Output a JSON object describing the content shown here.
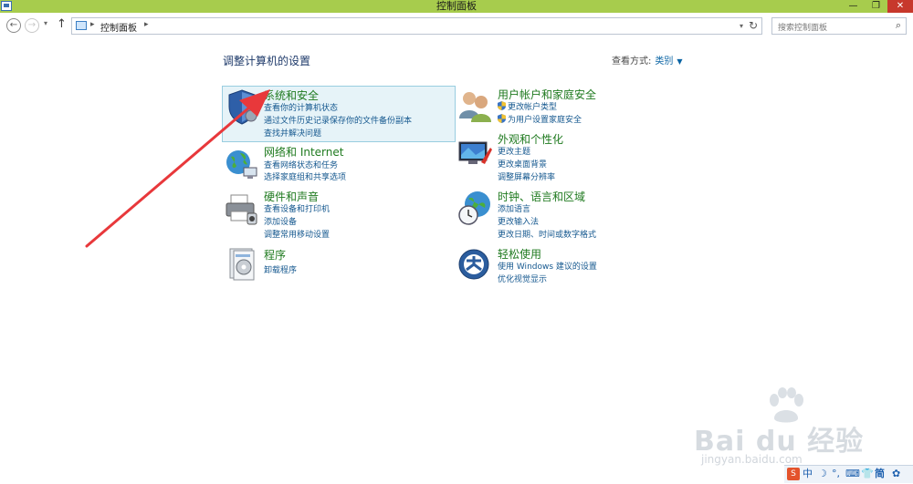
{
  "window": {
    "title": "控制面板",
    "min_glyph": "—",
    "max_glyph": "❐",
    "close_glyph": "✕",
    "titlebar_color": "#a7cc4d"
  },
  "navbar": {
    "back_glyph": "←",
    "forward_glyph": "→",
    "dropdown_glyph": "▾",
    "up_glyph": "↑",
    "breadcrumb_sep": "▸",
    "breadcrumb": "控制面板",
    "address_dropdown_glyph": "▾",
    "refresh_glyph": "↻",
    "search_placeholder": "搜索控制面板",
    "search_glyph": "⌕"
  },
  "content": {
    "heading": "调整计算机的设置",
    "viewby_label": "查看方式:",
    "viewby_value": "类别",
    "viewby_caret": "▼",
    "link_color": "#15588f",
    "title_color": "#1f7a1f"
  },
  "categories": [
    {
      "title": "系统和安全",
      "icon": "shield-icon",
      "links": [
        "查看你的计算机状态",
        "通过文件历史记录保存你的文件备份副本",
        "查找并解决问题"
      ]
    },
    {
      "title": "网络和 Internet",
      "icon": "network-globe-icon",
      "links": [
        "查看网络状态和任务",
        "选择家庭组和共享选项"
      ]
    },
    {
      "title": "硬件和声音",
      "icon": "printer-icon",
      "links": [
        "查看设备和打印机",
        "添加设备",
        "调整常用移动设置"
      ]
    },
    {
      "title": "程序",
      "icon": "programs-icon",
      "links": [
        "卸载程序"
      ]
    },
    {
      "title": "用户帐户和家庭安全",
      "icon": "users-icon",
      "links": [
        "更改帐户类型",
        "为用户设置家庭安全"
      ]
    },
    {
      "title": "外观和个性化",
      "icon": "appearance-icon",
      "links": [
        "更改主题",
        "更改桌面背景",
        "调整屏幕分辨率"
      ]
    },
    {
      "title": "时钟、语言和区域",
      "icon": "clock-globe-icon",
      "links": [
        "添加语言",
        "更改输入法",
        "更改日期、时间或数字格式"
      ]
    },
    {
      "title": "轻松使用",
      "icon": "ease-of-access-icon",
      "links": [
        "使用 Windows 建议的设置",
        "优化视觉显示"
      ]
    }
  ],
  "watermark": {
    "brand": "Bai du 经验",
    "url": "jingyan.baidu.com"
  },
  "tray": {
    "items": [
      "S",
      "中",
      "☽",
      "°,",
      "⌨",
      "👕",
      "简",
      "✿"
    ]
  }
}
